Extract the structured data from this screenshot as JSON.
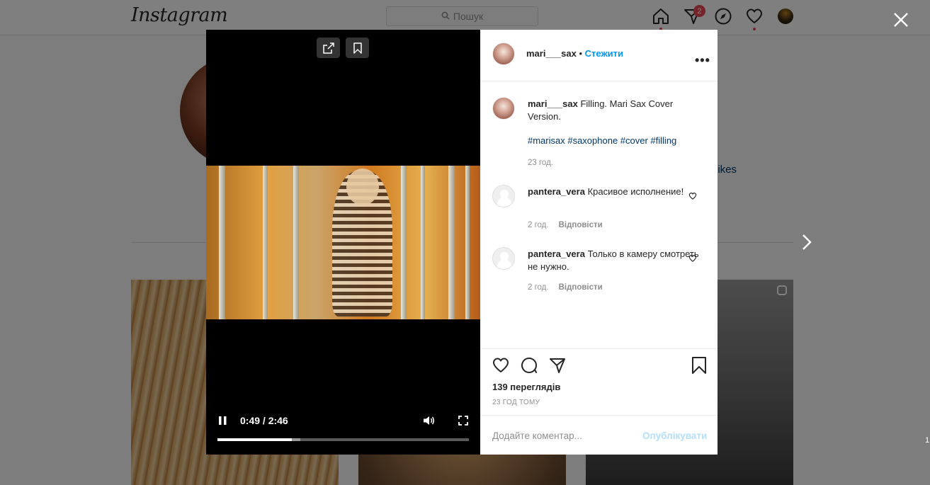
{
  "header": {
    "logo": "Instagram",
    "search_placeholder": "Пошук",
    "activity_badge": "2"
  },
  "background": {
    "likes_fragment": "likes"
  },
  "video": {
    "current_time": "0:49",
    "duration": "2:46",
    "time_display": "0:49 / 2:46",
    "progress_fraction": 0.295,
    "buffered_fraction": 0.33
  },
  "post": {
    "username": "mari___sax",
    "follow_label": "Стежити",
    "more_label": "•••",
    "caption": {
      "username": "mari___sax",
      "text": "Filling. Mari Sax Cover Version.",
      "hashtags": "#marisax #saxophone #cover #filling",
      "time": "23 год."
    },
    "comments": [
      {
        "username": "pantera_vera",
        "text": "Красивое исполнение!",
        "time": "2 год.",
        "reply_label": "Відповісти"
      },
      {
        "username": "pantera_vera",
        "text": "Только в камеру смотреть не нужно.",
        "time": "2 год.",
        "reply_label": "Відповісти"
      }
    ],
    "views": "139 переглядів",
    "posted_ago": "23 ГОД ТОМУ",
    "comment_placeholder": "Додайте коментар...",
    "publish_label": "Опублікувати"
  },
  "edge_text": "1",
  "colors": {
    "accent": "#0095f6",
    "hashtag": "#00376b",
    "badge": "#ed4956",
    "muted": "#8e8e8e"
  }
}
